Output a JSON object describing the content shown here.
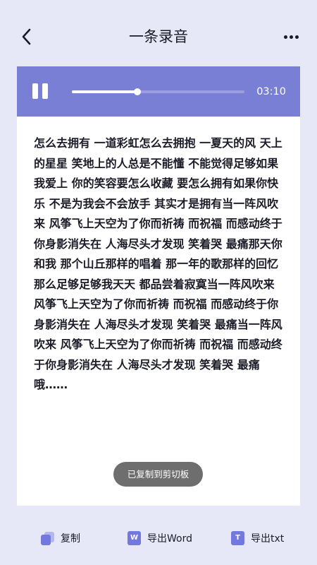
{
  "header": {
    "title": "一条录音"
  },
  "player": {
    "time": "03:10",
    "progress": 0.38
  },
  "transcript": {
    "text": "怎么去拥有 一道彩虹怎么去拥抱 一夏天的风 天上的星星 笑地上的人总是不能懂 不能觉得足够如果我爱上 你的笑容要怎么收藏 要怎么拥有如果你快乐 不是为我会不会放手 其实才是拥有当一阵风吹来 风筝飞上天空为了你而祈祷 而祝福 而感动终于你身影消失在 人海尽头才发现 笑着哭 最痛那天你和我 那个山丘那样的唱着 那一年的歌那样的回忆 那么足够足够我天天 都品尝着寂寞当一阵风吹来 风筝飞上天空为了你而祈祷 而祝福 而感动终于你身影消失在 人海尽头才发现 笑着哭 最痛当一阵风吹来 风筝飞上天空为了你而祈祷 而祝福 而感动终于你身影消失在 人海尽头才发现 笑着哭 最痛哦……"
  },
  "toast": {
    "text": "已复制到剪切板"
  },
  "actions": {
    "copy_label": "复制",
    "word_label": "导出Word",
    "word_icon_letter": "W",
    "txt_label": "导出txt",
    "txt_icon_letter": "T"
  },
  "colors": {
    "background": "#e6e8f8",
    "accent": "#7a7fd6",
    "icon": "#7278dd",
    "toast": "#6e6e6e"
  },
  "icons": {
    "back": "chevron-left-icon",
    "more": "more-horizontal-icon",
    "pause": "pause-icon",
    "copy": "copy-icon",
    "word": "word-file-icon",
    "txt": "txt-file-icon"
  }
}
